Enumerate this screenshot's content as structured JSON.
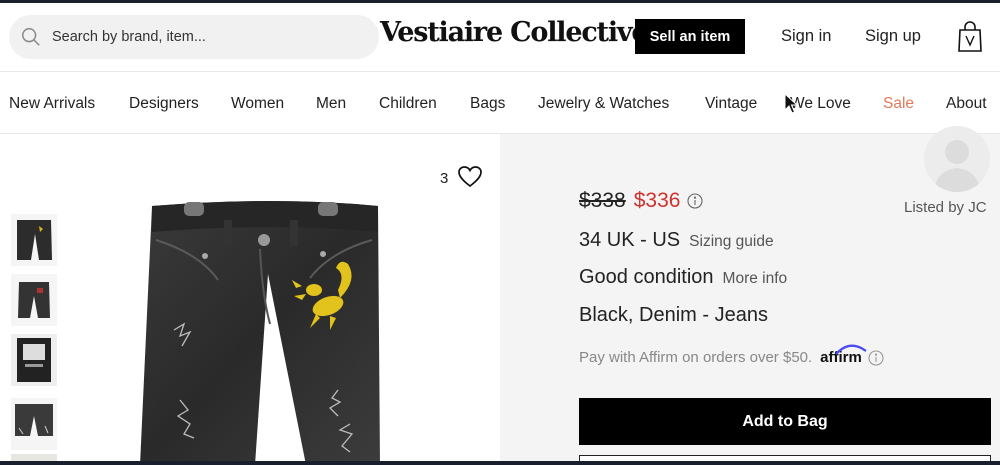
{
  "header": {
    "search_placeholder": "Search by brand, item...",
    "logo": "Vestiaire Collective",
    "sell_label": "Sell an item",
    "sign_in": "Sign in",
    "sign_up": "Sign up"
  },
  "nav": {
    "items": [
      "New Arrivals",
      "Designers",
      "Women",
      "Men",
      "Children",
      "Bags",
      "Jewelry & Watches",
      "Vintage",
      "We Love",
      "Sale",
      "About"
    ]
  },
  "product": {
    "likes": "3",
    "old_price": "$338",
    "new_price": "$336",
    "size": "34 UK - US",
    "size_guide": "Sizing guide",
    "condition": "Good condition",
    "more_info": "More info",
    "material": "Black, Denim - Jeans",
    "affirm_text": "Pay with Affirm on orders over $50.",
    "affirm_logo": "affirm",
    "add_to_bag": "Add to Bag",
    "listed_by": "Listed by JC"
  },
  "colors": {
    "sale": "#e07b5a",
    "price_red": "#d0312d",
    "button_black": "#000000",
    "panel_gray": "#f4f4f4"
  }
}
